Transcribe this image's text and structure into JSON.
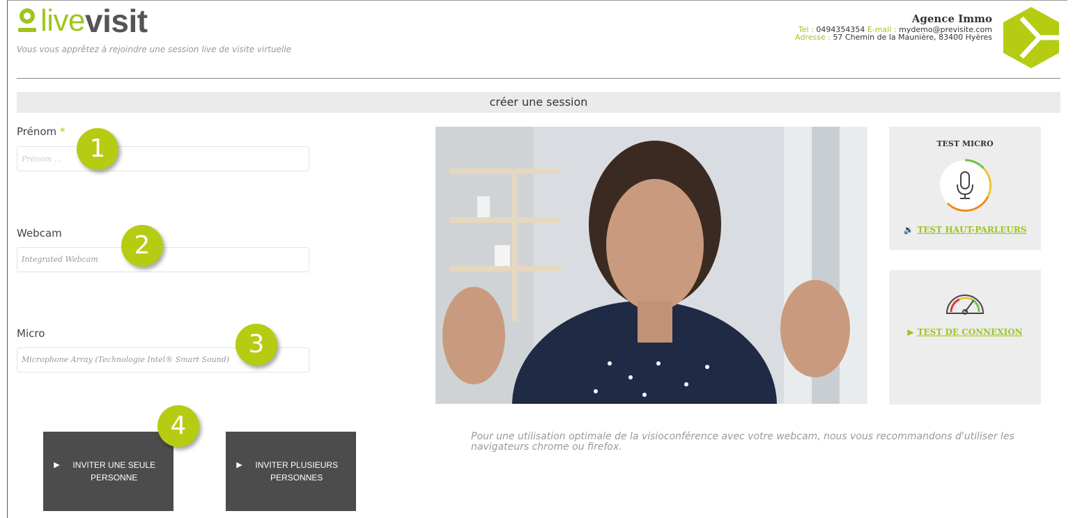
{
  "header": {
    "logo_live": "live",
    "logo_visit": "visit",
    "tagline": "Vous vous apprêtez à rejoindre une session live de visite virtuelle",
    "agency": {
      "name": "Agence Immo",
      "tel_label": "Tel :",
      "tel": "0494354354",
      "email_label": "E-mail :",
      "email": "mydemo@previsite.com",
      "address_label": "Adresse :",
      "address": "57 Chemin de la Maunière, 83400 Hyères"
    }
  },
  "session_title": "créer une session",
  "form": {
    "firstname_label": "Prénom",
    "required_mark": "*",
    "firstname_placeholder": "Prénom ...",
    "webcam_label": "Webcam",
    "webcam_value": "Integrated Webcam",
    "micro_label": "Micro",
    "micro_value": "Microphone Array (Technologie Intel® Smart Sound)"
  },
  "badges": [
    "1",
    "2",
    "3",
    "4"
  ],
  "buttons": {
    "invite_single": "INVITER UNE SEULE PERSONNE",
    "invite_multiple": "INVITER PLUSIEURS PERSONNES"
  },
  "panels": {
    "mic_title": "TEST MICRO",
    "speaker_link": "TEST HAUT-PARLEURS",
    "connection_link": "TEST DE CONNEXION"
  },
  "notice": "Pour une utilisation optimale de la visioconférence avec votre webcam, nous vous recommandons d'utiliser les navigateurs chrome ou firefox.",
  "colors": {
    "accent": "#9ec51f",
    "badge": "#b5cc12",
    "button_bg": "#4c4c4c",
    "panel_bg": "#ededed"
  },
  "icons": [
    "logo-pin-icon",
    "agency-hexagon-logo",
    "microphone-icon",
    "speaker-icon",
    "speedometer-icon",
    "play-icon"
  ]
}
